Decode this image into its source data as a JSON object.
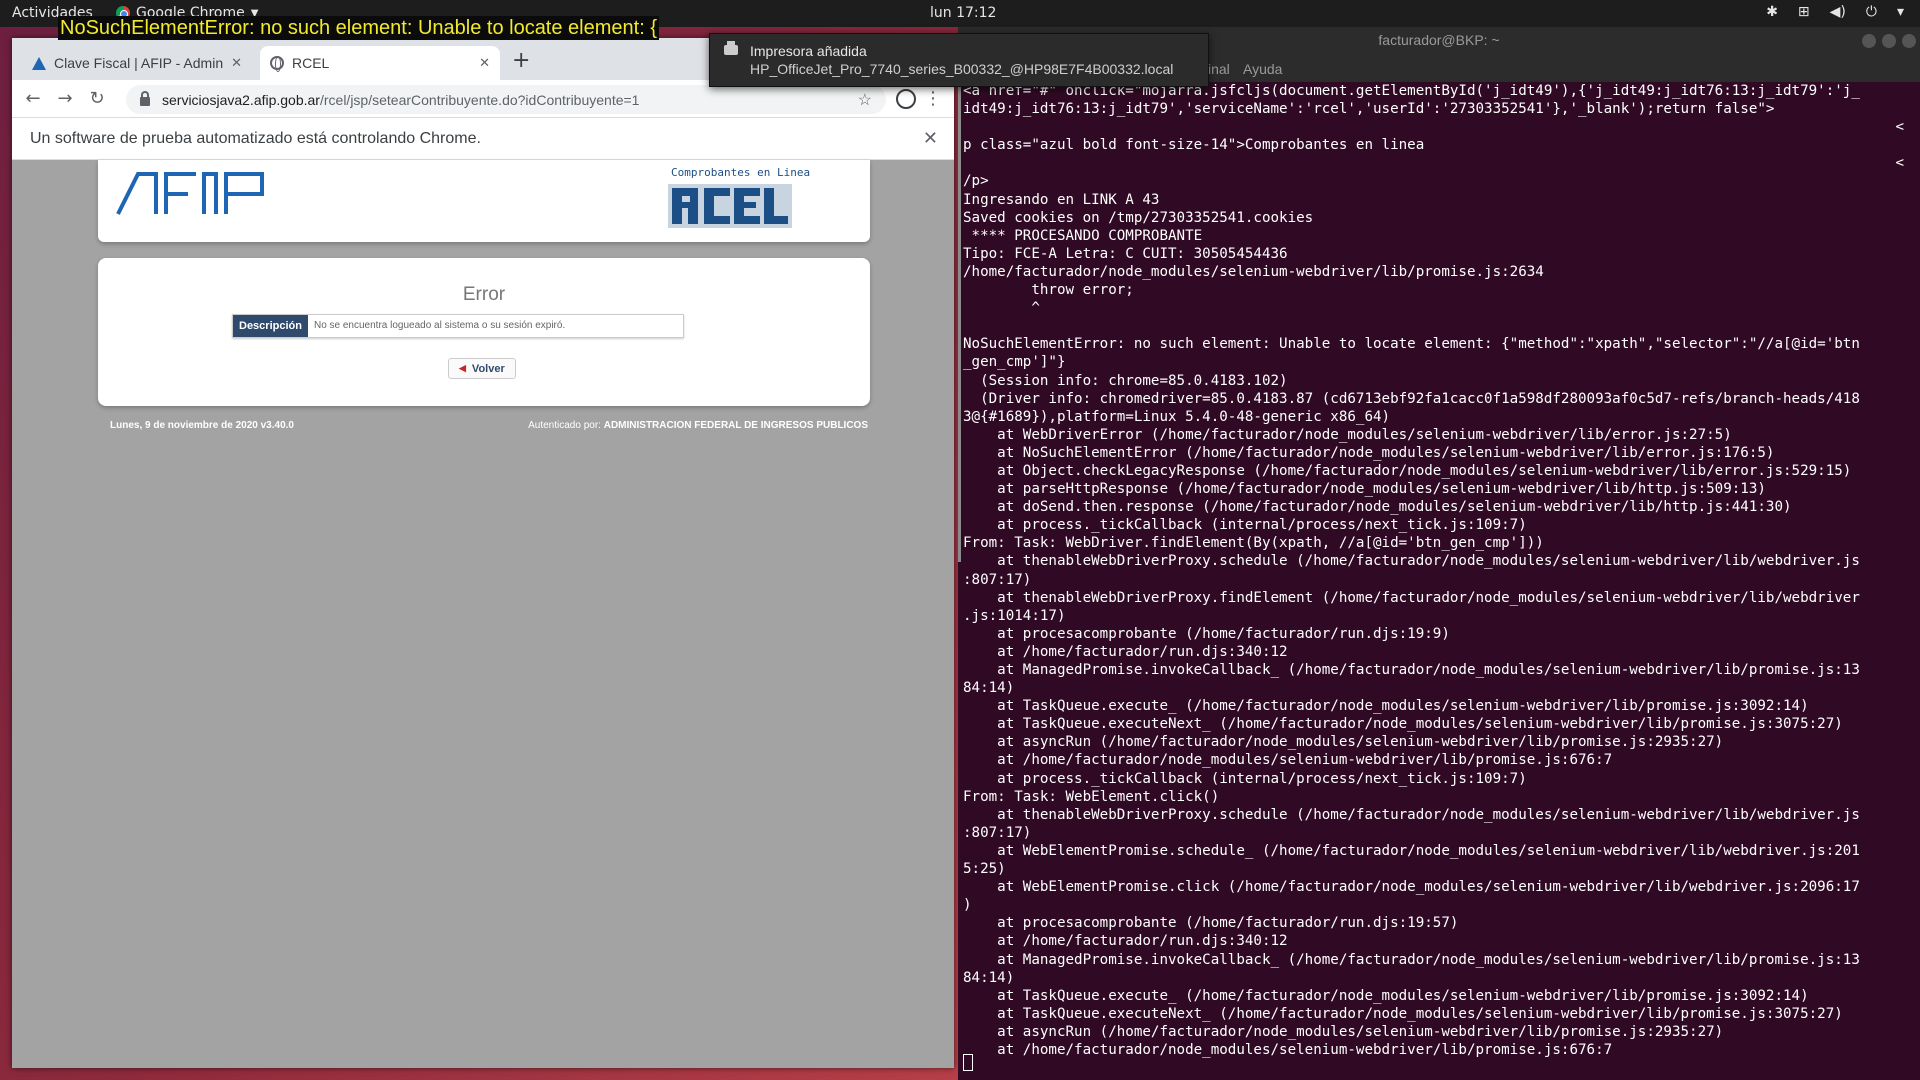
{
  "topbar": {
    "activities": "Actividades",
    "app_name": "Google Chrome",
    "clock": "lun 17:12"
  },
  "overlay": {
    "error_text": "NoSuchElementError: no such element: Unable to locate element: {"
  },
  "notification": {
    "title": "Impresora añadida",
    "body": "HP_OfficeJet_Pro_7740_series_B00332_@HP98E7F4B00332.local"
  },
  "chrome": {
    "tabs": [
      {
        "title": "Clave Fiscal | AFIP - Admin"
      },
      {
        "title": "RCEL"
      }
    ],
    "url_host": "serviciosjava2.afip.gob.ar",
    "url_path": "/rcel/jsp/setearContribuyente.do?idContribuyente=1",
    "infobar_text": "Un software de prueba automatizado está controlando Chrome."
  },
  "page": {
    "rcel_caption": "Comprobantes en Linea",
    "error_title": "Error",
    "desc_label": "Descripción",
    "desc_value": "No se encuentra logueado al sistema o su sesión expiró.",
    "back_button": "Volver",
    "footer_date": "Lunes, 9 de noviembre de 2020 v3.40.0",
    "footer_auth_prefix": "Autenticado por:",
    "footer_auth_org": "ADMINISTRACION FEDERAL DE INGRESOS PUBLICOS"
  },
  "terminal": {
    "title": "facturador@BKP: ~",
    "menu_items": [
      "inal",
      "Ayuda"
    ],
    "lines": [
      "<a href=\"#\" onclick=\"mojarra.jsfcljs(document.getElementById('j_idt49'),{'j_idt49:j_idt76:13:j_idt79':'j_",
      "idt49:j_idt76:13:j_idt79','serviceName':'rcel','userId':'27303352541'},'_blank');return false\">",
      "<",
      "p class=\"azul bold font-size-14\">Comprobantes en linea",
      "<",
      "/p>",
      "Ingresando en LINK A 43",
      "Saved cookies on /tmp/27303352541.cookies",
      " **** PROCESANDO COMPROBANTE",
      "Tipo: FCE-A Letra: C CUIT: 30505454436",
      "/home/facturador/node_modules/selenium-webdriver/lib/promise.js:2634",
      "        throw error;",
      "        ^",
      "",
      "NoSuchElementError: no such element: Unable to locate element: {\"method\":\"xpath\",\"selector\":\"//a[@id='btn",
      "_gen_cmp']\"}",
      "  (Session info: chrome=85.0.4183.102)",
      "  (Driver info: chromedriver=85.0.4183.87 (cd6713ebf92fa1cacc0f1a598df280093af0c5d7-refs/branch-heads/418",
      "3@{#1689}),platform=Linux 5.4.0-48-generic x86_64)",
      "    at WebDriverError (/home/facturador/node_modules/selenium-webdriver/lib/error.js:27:5)",
      "    at NoSuchElementError (/home/facturador/node_modules/selenium-webdriver/lib/error.js:176:5)",
      "    at Object.checkLegacyResponse (/home/facturador/node_modules/selenium-webdriver/lib/error.js:529:15)",
      "    at parseHttpResponse (/home/facturador/node_modules/selenium-webdriver/lib/http.js:509:13)",
      "    at doSend.then.response (/home/facturador/node_modules/selenium-webdriver/lib/http.js:441:30)",
      "    at process._tickCallback (internal/process/next_tick.js:109:7)",
      "From: Task: WebDriver.findElement(By(xpath, //a[@id='btn_gen_cmp']))",
      "    at thenableWebDriverProxy.schedule (/home/facturador/node_modules/selenium-webdriver/lib/webdriver.js",
      ":807:17)",
      "    at thenableWebDriverProxy.findElement (/home/facturador/node_modules/selenium-webdriver/lib/webdriver",
      ".js:1014:17)",
      "    at procesacomprobante (/home/facturador/run.djs:19:9)",
      "    at /home/facturador/run.djs:340:12",
      "    at ManagedPromise.invokeCallback_ (/home/facturador/node_modules/selenium-webdriver/lib/promise.js:13",
      "84:14)",
      "    at TaskQueue.execute_ (/home/facturador/node_modules/selenium-webdriver/lib/promise.js:3092:14)",
      "    at TaskQueue.executeNext_ (/home/facturador/node_modules/selenium-webdriver/lib/promise.js:3075:27)",
      "    at asyncRun (/home/facturador/node_modules/selenium-webdriver/lib/promise.js:2935:27)",
      "    at /home/facturador/node_modules/selenium-webdriver/lib/promise.js:676:7",
      "    at process._tickCallback (internal/process/next_tick.js:109:7)",
      "From: Task: WebElement.click()",
      "    at thenableWebDriverProxy.schedule (/home/facturador/node_modules/selenium-webdriver/lib/webdriver.js",
      ":807:17)",
      "    at WebElementPromise.schedule_ (/home/facturador/node_modules/selenium-webdriver/lib/webdriver.js:201",
      "5:25)",
      "    at WebElementPromise.click (/home/facturador/node_modules/selenium-webdriver/lib/webdriver.js:2096:17",
      ")",
      "    at procesacomprobante (/home/facturador/run.djs:19:57)",
      "    at /home/facturador/run.djs:340:12",
      "    at ManagedPromise.invokeCallback_ (/home/facturador/node_modules/selenium-webdriver/lib/promise.js:13",
      "84:14)",
      "    at TaskQueue.execute_ (/home/facturador/node_modules/selenium-webdriver/lib/promise.js:3092:14)",
      "    at TaskQueue.executeNext_ (/home/facturador/node_modules/selenium-webdriver/lib/promise.js:3075:27)",
      "    at asyncRun (/home/facturador/node_modules/selenium-webdriver/lib/promise.js:2935:27)",
      "    at /home/facturador/node_modules/selenium-webdriver/lib/promise.js:676:7"
    ]
  },
  "icons": {
    "chrome": "chrome-icon",
    "back": "back-arrow-icon",
    "forward": "forward-arrow-icon",
    "reload": "reload-icon",
    "lock": "lock-icon",
    "star": "star-icon",
    "profile": "profile-icon",
    "menu": "kebab-menu-icon",
    "printer": "printer-icon"
  },
  "colors": {
    "terminal_bg": "#300a24",
    "overlay_text": "#f2ea2c",
    "afip_blue": "#1e66b3"
  }
}
